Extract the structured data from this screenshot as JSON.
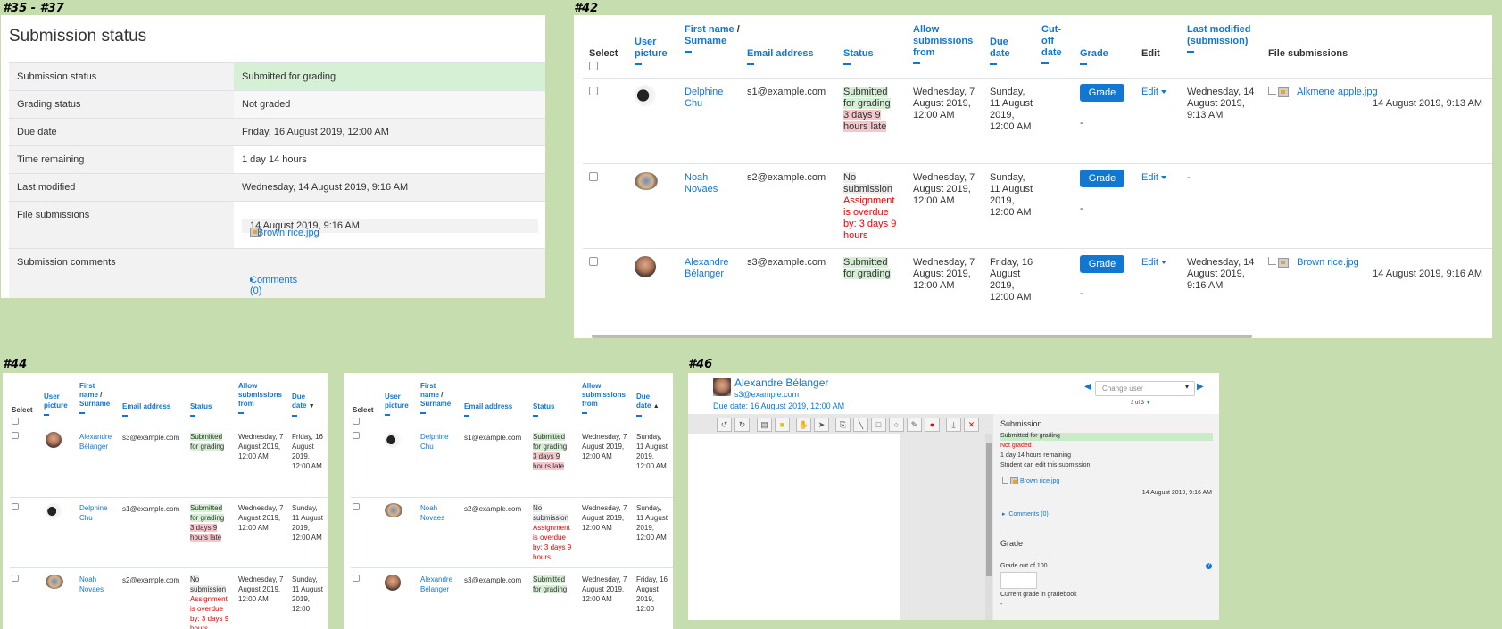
{
  "labels": {
    "a": "#35 - #37",
    "b": "#42",
    "c": "#44",
    "e": "#46"
  },
  "status_panel": {
    "title": "Submission status",
    "rows": [
      {
        "k": "Submission status",
        "v": "Submitted for grading"
      },
      {
        "k": "Grading status",
        "v": "Not graded"
      },
      {
        "k": "Due date",
        "v": "Friday, 16 August 2019, 12:00 AM"
      },
      {
        "k": "Time remaining",
        "v": "1 day 14 hours"
      },
      {
        "k": "Last modified",
        "v": "Wednesday, 14 August 2019, 9:16 AM"
      },
      {
        "k": "File submissions",
        "v": ""
      },
      {
        "k": "Submission comments",
        "v": ""
      }
    ],
    "file": {
      "name": "Brown rice.jpg",
      "date": "14 August 2019, 9:16 AM"
    },
    "comments": "Comments (0)"
  },
  "headers": {
    "select": "Select",
    "user_picture": "User picture",
    "first_name": "First name",
    "slash": "/",
    "surname": "Surname",
    "email": "Email address",
    "status": "Status",
    "allow": "Allow submissions from",
    "due": "Due date",
    "cutoff": "Cut-off date",
    "grade": "Grade",
    "edit": "Edit",
    "last_modified": "Last modified (submission)",
    "file_submissions": "File submissions"
  },
  "status_words": {
    "submitted": "Submitted for grading",
    "late": "3 days 9 hours late",
    "none": "No submission",
    "overdue": "Assignment is overdue by: 3 days 9 hours"
  },
  "table_b": {
    "grade_label": "Grade",
    "edit_label": "Edit",
    "rows": [
      {
        "first": "Delphine",
        "last": "Chu",
        "email": "s1@example.com",
        "allow": "Wednesday, 7 August 2019, 12:00 AM",
        "due": "Sunday, 11 August 2019, 12:00 AM",
        "grade_val": "-",
        "modified": "Wednesday, 14 August 2019, 9:13 AM",
        "file": "Alkmene apple.jpg",
        "file_date": "14 August 2019, 9:13 AM"
      },
      {
        "first": "Noah",
        "last": "Novaes",
        "email": "s2@example.com",
        "allow": "Wednesday, 7 August 2019, 12:00 AM",
        "due": "Sunday, 11 August 2019, 12:00 AM",
        "grade_val": "-",
        "modified": "-",
        "file": "",
        "file_date": ""
      },
      {
        "first": "Alexandre",
        "last": "Bélanger",
        "email": "s3@example.com",
        "allow": "Wednesday, 7 August 2019, 12:00 AM",
        "due": "Friday, 16 August 2019, 12:00 AM",
        "grade_val": "-",
        "modified": "Wednesday, 14 August 2019, 9:16 AM",
        "file": "Brown rice.jpg",
        "file_date": "14 August 2019, 9:16 AM"
      }
    ]
  },
  "table_c": {
    "rows": [
      {
        "first": "Alexandre",
        "last": "Bélanger",
        "email": "s3@example.com",
        "allow": "Wednesday, 7 August 2019, 12:00 AM",
        "due": "Friday, 16 August 2019, 12:00 AM"
      },
      {
        "first": "Delphine",
        "last": "Chu",
        "email": "s1@example.com",
        "allow": "Wednesday, 7 August 2019, 12:00 AM",
        "due": "Sunday, 11 August 2019, 12:00 AM"
      },
      {
        "first": "Noah",
        "last": "Novaes",
        "email": "s2@example.com",
        "allow": "Wednesday, 7 August 2019, 12:00 AM",
        "due": "Sunday, 11 August 2019, 12:00"
      }
    ]
  },
  "table_d": {
    "rows": [
      {
        "first": "Delphine",
        "last": "Chu",
        "email": "s1@example.com",
        "allow": "Wednesday, 7 August 2019, 12:00 AM",
        "due": "Sunday, 11 August 2019, 12:00 AM"
      },
      {
        "first": "Noah",
        "last": "Novaes",
        "email": "s2@example.com",
        "allow": "Wednesday, 7 August 2019, 12:00 AM",
        "due": "Sunday, 11 August 2019, 12:00 AM"
      },
      {
        "first": "Alexandre",
        "last": "Bélanger",
        "email": "s3@example.com",
        "allow": "Wednesday, 7 August 2019, 12:00 AM",
        "due": "Friday, 16 August 2019, 12:00"
      }
    ]
  },
  "grader": {
    "name": "Alexandre Bélanger",
    "email": "s3@example.com",
    "due": "Due date: 16 August 2019, 12:00 AM",
    "change_user": "Change user",
    "count": "3 of 3",
    "submission_title": "Submission",
    "status": "Submitted for grading",
    "grading": "Not graded",
    "remaining": "1 day 14 hours remaining",
    "can_edit": "Student can edit this submission",
    "file": "Brown rice.jpg",
    "file_date": "14 August 2019, 9:16 AM",
    "comments": "Comments (0)",
    "grade_title": "Grade",
    "grade_out_of": "Grade out of 100",
    "current_grade": "Current grade in gradebook",
    "current_value": "-"
  },
  "colors": {
    "background": "#c6ddb0",
    "accent": "#1177d1",
    "submitted": "#d6f0d6",
    "late": "#f5c6cb",
    "overdue": "#e00000"
  }
}
